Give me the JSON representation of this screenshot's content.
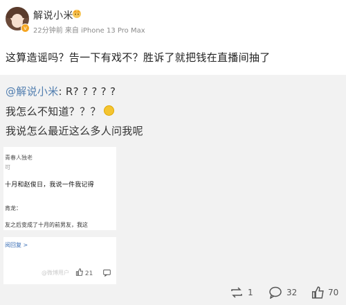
{
  "header": {
    "username": "解说小米",
    "meta": "22分钟前 来自 iPhone 13 Pro Max"
  },
  "post": {
    "text": "这算造谣吗？告一下有戏不？胜诉了就把钱在直播间抽了"
  },
  "quoted": {
    "mention": "@解说小米",
    "line1_rest": ": R? ? ? ? ?",
    "line2": "我怎么不知道？？？",
    "line3": "我说怎么最近这么多人问我呢"
  },
  "screenshot": {
    "title": "青春人独老",
    "sub": "可",
    "body1": "十月和赵俊日，我说一件我记得",
    "speaker": "肯龙：",
    "body2": "友之后变成了十月的前男友，我这",
    "reply_link": "阅回复 >",
    "watermark": "@微博用户",
    "like_count": "21"
  },
  "actions": {
    "repost_count": "1",
    "comment_count": "32",
    "like_count": "70"
  }
}
